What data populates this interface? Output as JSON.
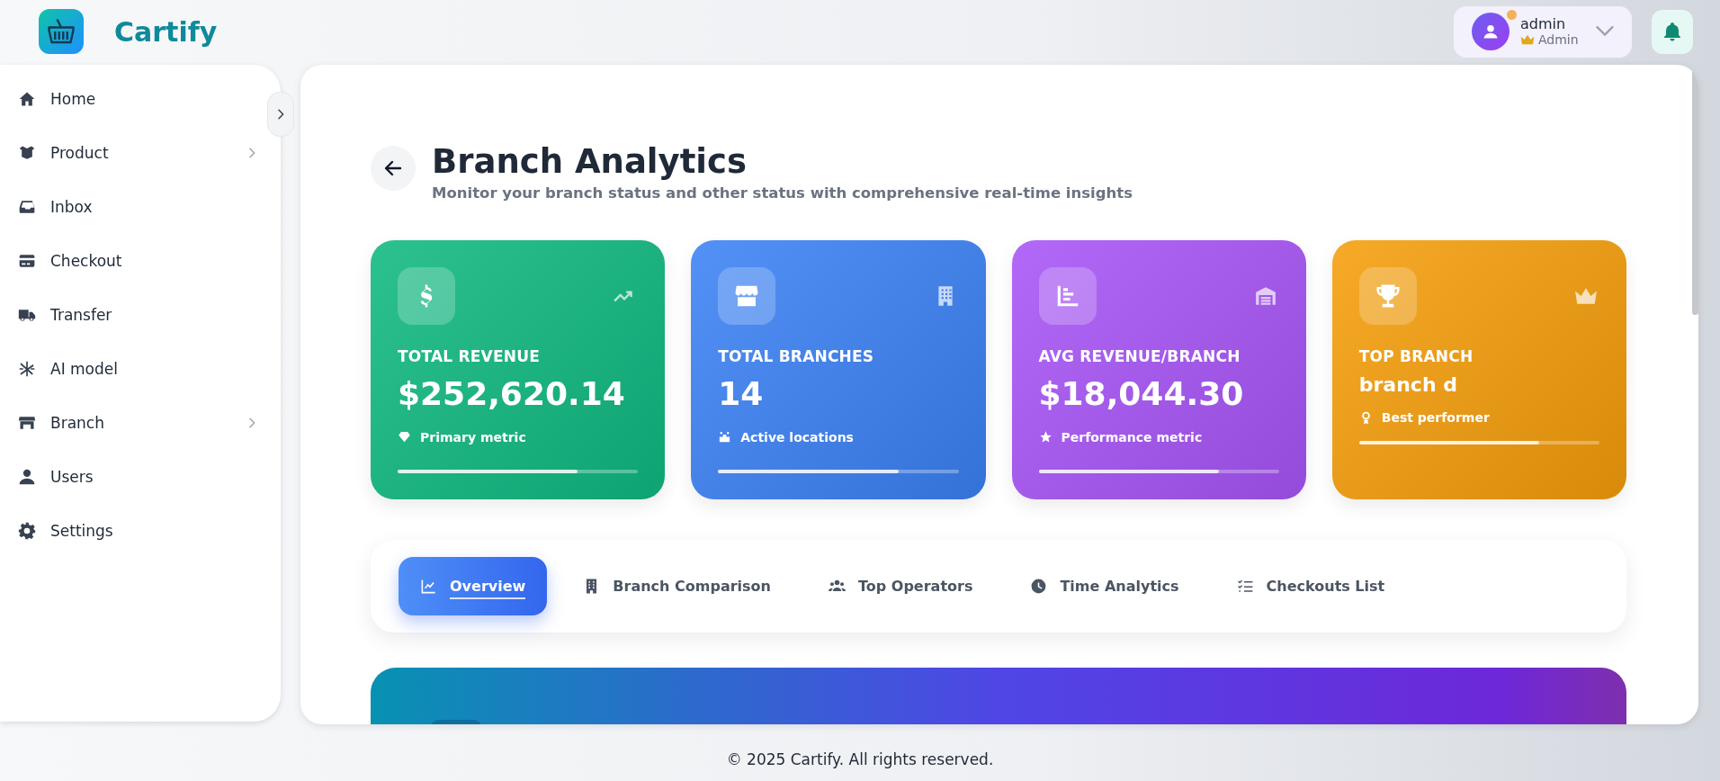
{
  "brand": {
    "name": "Cartify"
  },
  "user": {
    "name": "admin",
    "role": "Admin",
    "online": true
  },
  "sidebar": {
    "items": [
      {
        "label": "Home",
        "has_submenu": false
      },
      {
        "label": "Product",
        "has_submenu": true
      },
      {
        "label": "Inbox",
        "has_submenu": false
      },
      {
        "label": "Checkout",
        "has_submenu": false
      },
      {
        "label": "Transfer",
        "has_submenu": false
      },
      {
        "label": "AI model",
        "has_submenu": false
      },
      {
        "label": "Branch",
        "has_submenu": true
      },
      {
        "label": "Users",
        "has_submenu": false
      },
      {
        "label": "Settings",
        "has_submenu": false
      }
    ]
  },
  "page": {
    "title": "Branch Analytics",
    "subtitle": "Monitor your branch status and other status with comprehensive real-time insights"
  },
  "cards": [
    {
      "kind": "amount",
      "label": "TOTAL REVENUE",
      "value": "$252,620.14",
      "note": "Primary metric",
      "level": 0.75,
      "color": "#10b981"
    },
    {
      "kind": "amount",
      "label": "TOTAL BRANCHES",
      "value": "14",
      "note": "Active locations",
      "level": 0.75,
      "color": "#3b82f6"
    },
    {
      "kind": "amount",
      "label": "AVG REVENUE/BRANCH",
      "value": "$18,044.30",
      "note": "Performance metric",
      "level": 0.75,
      "color": "#a855f7"
    },
    {
      "kind": "name",
      "label": "TOP BRANCH",
      "value": "branch d",
      "note": "Best performer",
      "level": 0.75,
      "color": "#f59e0b"
    }
  ],
  "tabs": [
    {
      "label": "Overview",
      "selected": true
    },
    {
      "label": "Branch Comparison",
      "selected": false
    },
    {
      "label": "Top Operators",
      "selected": false
    },
    {
      "label": "Time Analytics",
      "selected": false
    },
    {
      "label": "Checkouts List",
      "selected": false
    }
  ],
  "footer": {
    "text": "© 2025 Cartify. All rights reserved."
  }
}
